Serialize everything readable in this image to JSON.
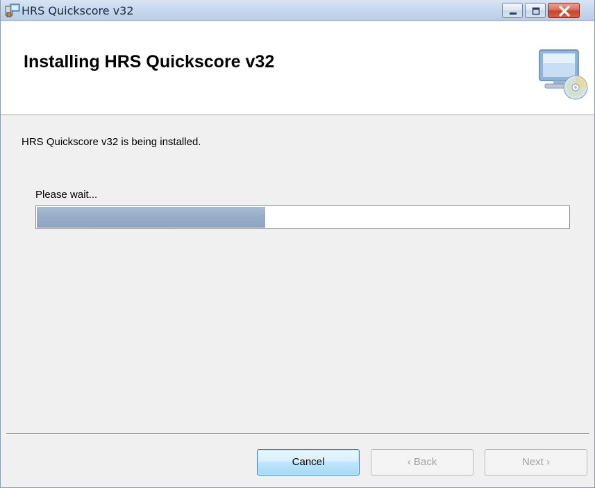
{
  "window": {
    "title": "HRS Quickscore v32",
    "icons": {
      "app": "installer-icon",
      "minimize": "minimize-icon",
      "maximize": "maximize-icon",
      "close": "close-icon"
    }
  },
  "banner": {
    "title": "Installing HRS Quickscore v32",
    "icon": "computer-disc-icon"
  },
  "body": {
    "status": "HRS Quickscore v32 is being installed.",
    "wait_label": "Please wait...",
    "progress_fraction": 0.43
  },
  "footer": {
    "cancel_label": "Cancel",
    "back_label": "‹ Back",
    "next_label": "Next ›"
  },
  "colors": {
    "progress_fill": "#97acc8",
    "close_button": "#c8452d",
    "default_button_border": "#3c7fb1"
  }
}
